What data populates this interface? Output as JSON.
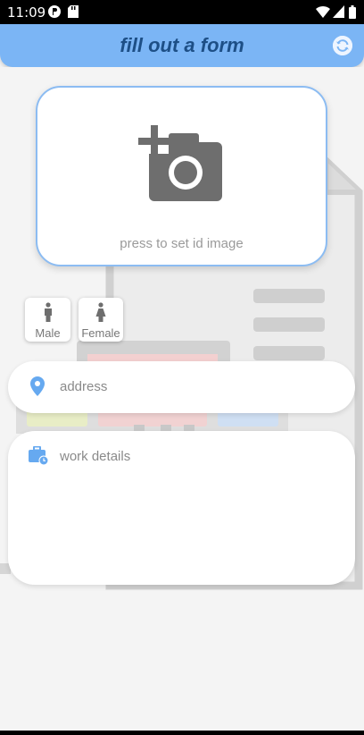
{
  "status_bar": {
    "time": "11:09",
    "icons": [
      "notification-icon",
      "sd-card-icon",
      "wifi-icon",
      "signal-icon",
      "battery-icon"
    ]
  },
  "app_bar": {
    "title": "fill out a form",
    "refresh_icon": "refresh-icon",
    "color": "#7bb5f5",
    "title_color": "#1d4f86"
  },
  "id_image": {
    "label": "press to set id image",
    "icon": "add-a-photo-icon"
  },
  "gender": {
    "options": [
      {
        "label": "Male",
        "icon": "male-icon"
      },
      {
        "label": "Female",
        "icon": "female-icon"
      }
    ]
  },
  "address": {
    "placeholder": "address",
    "icon": "location-pin-icon"
  },
  "work_details": {
    "placeholder": "work details",
    "icon": "work-history-icon"
  },
  "accent_color": "#66a9f0"
}
